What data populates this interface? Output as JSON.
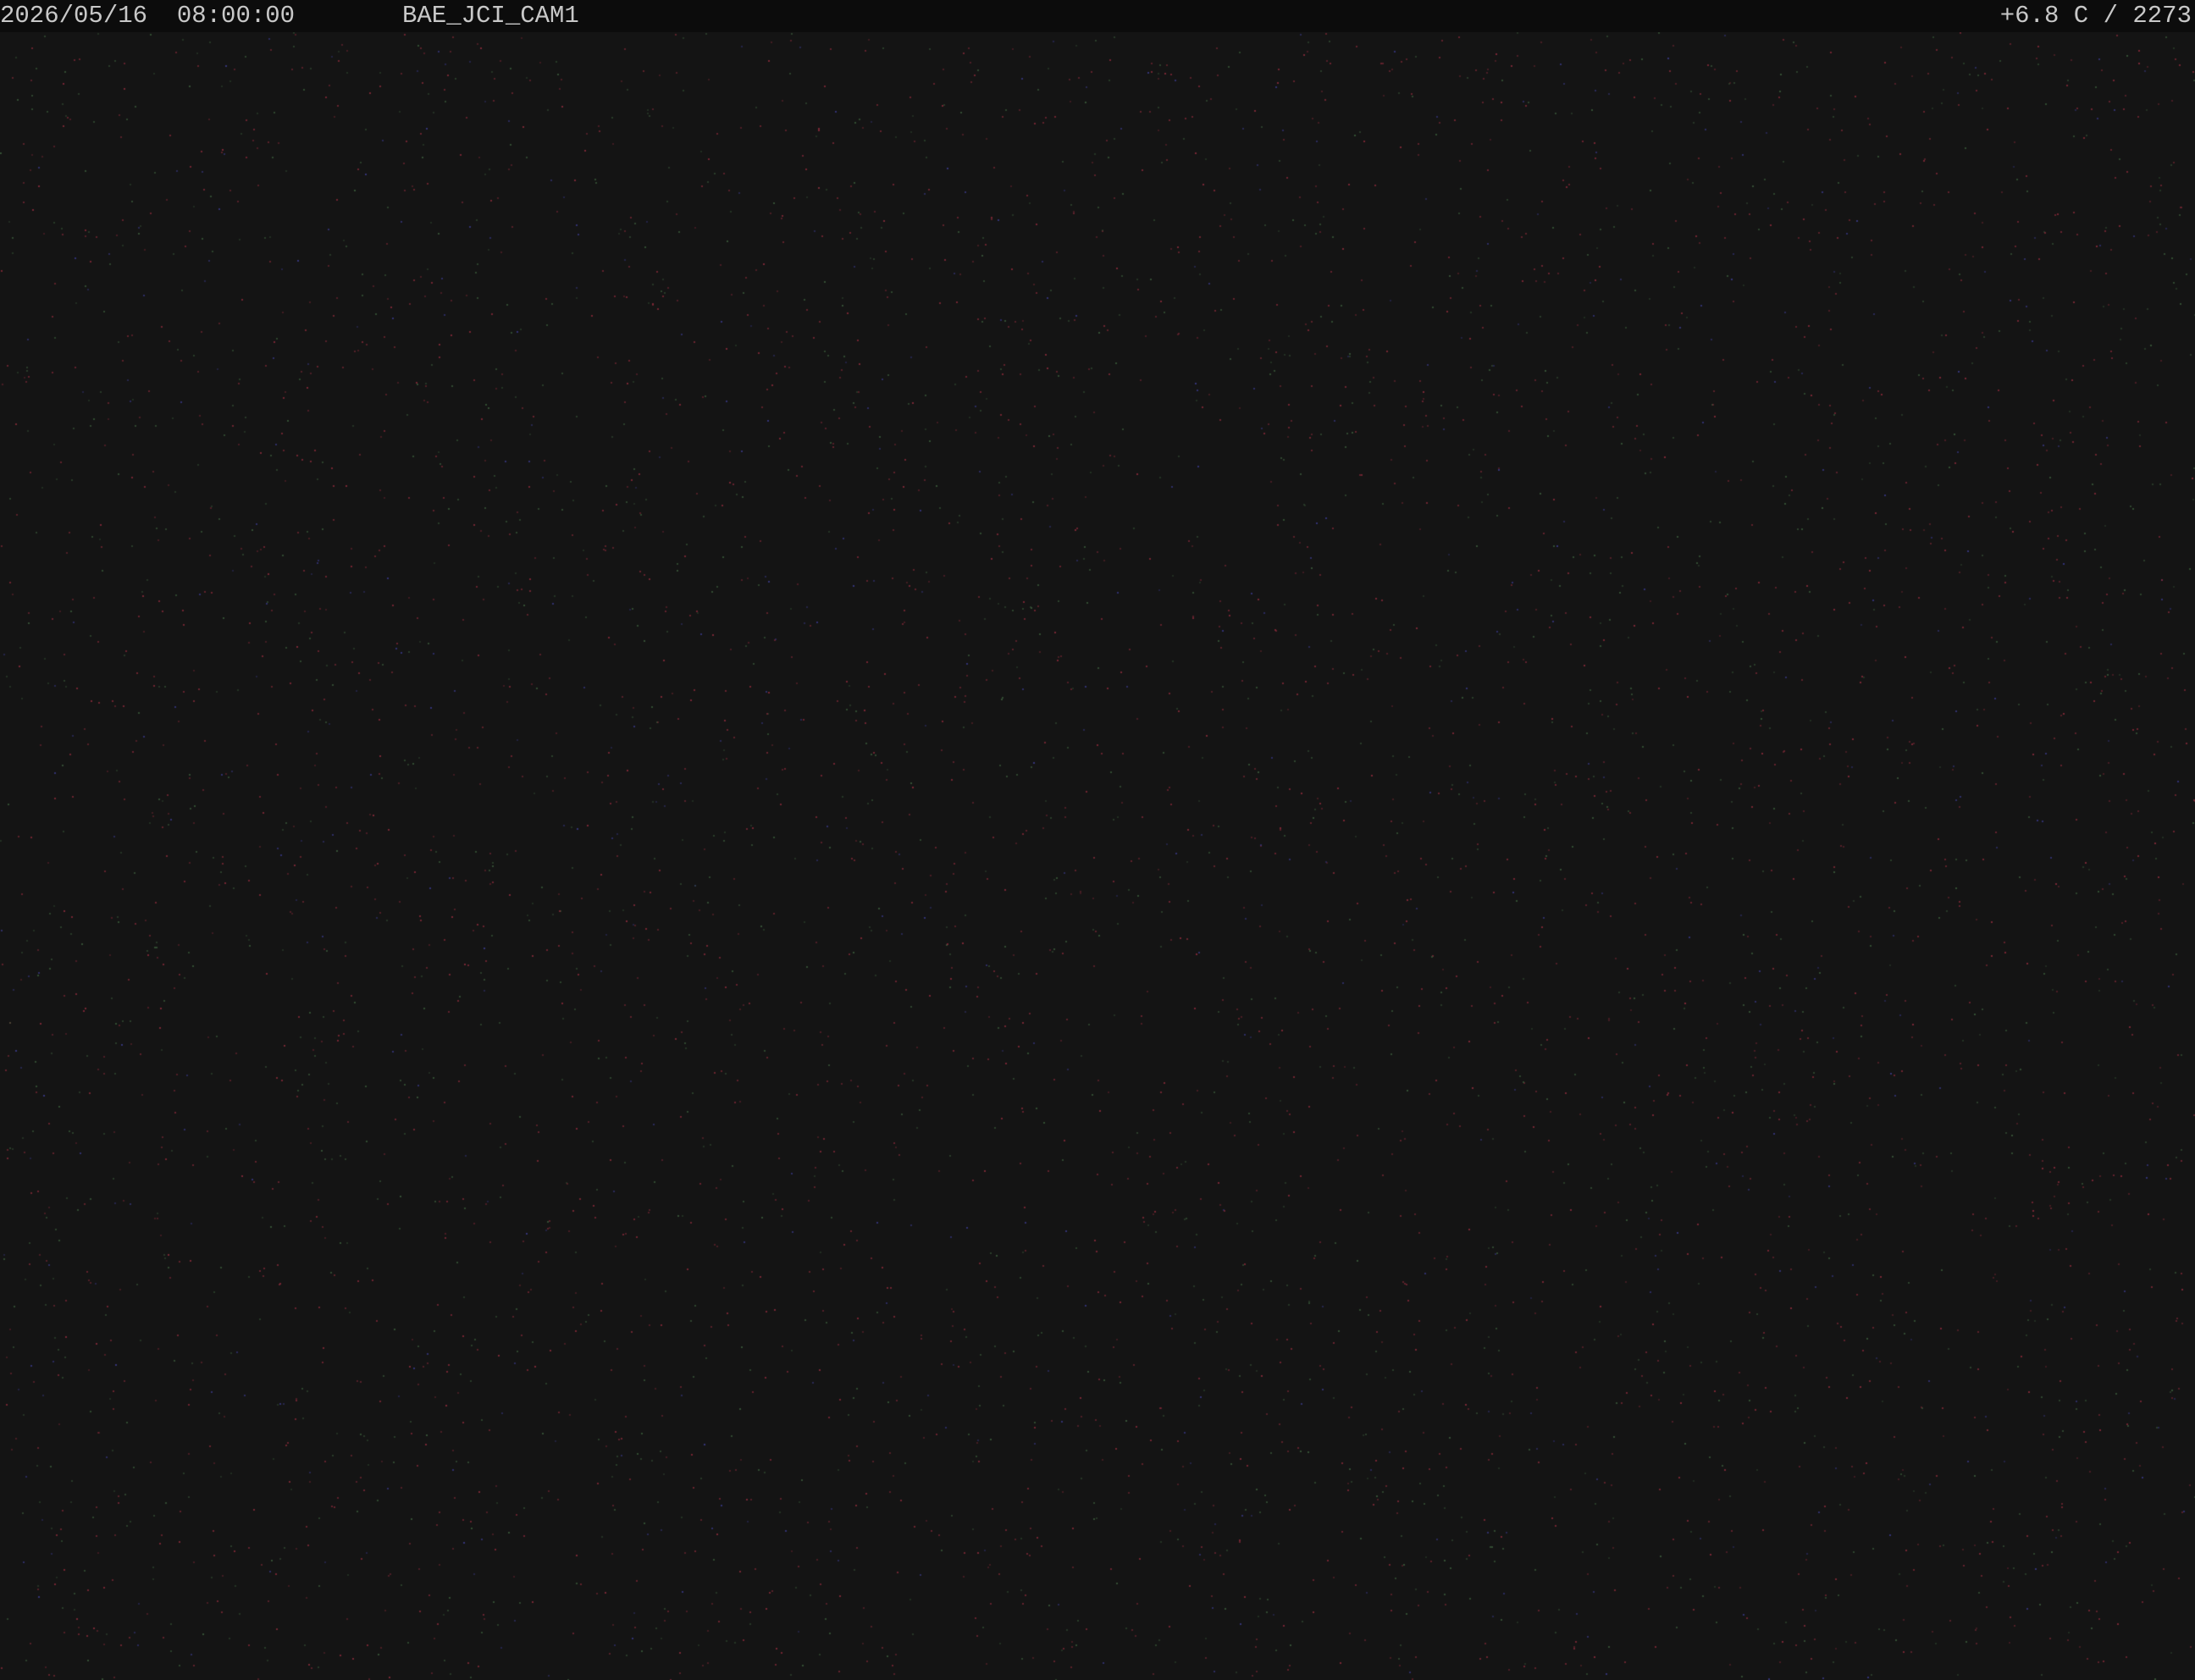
{
  "overlay": {
    "datetime": "2026/05/16  08:00:00",
    "camera_name": "BAE_JCI_CAM1",
    "readout": "+6.8 C / 2273"
  },
  "colors": {
    "background": "#141414",
    "overlay_bar": "#0c0c0c",
    "overlay_text": "#c8c8c8",
    "noise_red": "#8a2a3a",
    "noise_green": "#3a5a3a",
    "noise_blue": "#3a3a8a"
  }
}
